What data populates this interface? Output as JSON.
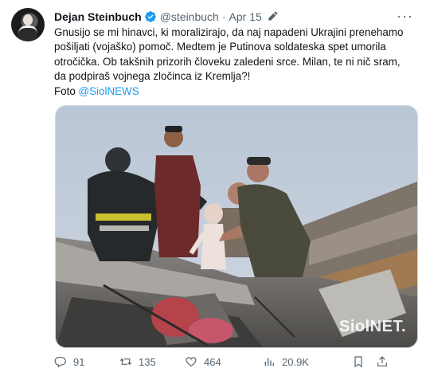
{
  "tweet": {
    "author_name": "Dejan Steinbuch",
    "handle": "@steinbuch",
    "separator": "·",
    "date": "Apr 15",
    "text_lines": [
      "Gnusijo se mi hinavci, ki moralizirajo, da naj napadeni Ukrajini prenehamo",
      "pošiljati (vojaško) pomoč. Medtem je Putinova soldateska spet umorila",
      "otročička. Ob takšnih prizorih človeku zaledeni srce. Milan, te ni nič sram,",
      "da podpiraš vojnega zločinca iz Kremlja?!"
    ],
    "foto_label": "Foto",
    "foto_mention": "@SiolNEWS",
    "more_label": "···"
  },
  "media": {
    "watermark": "SiolNET."
  },
  "stats": {
    "replies": "91",
    "retweets": "135",
    "likes": "464",
    "views": "20.9K"
  },
  "colors": {
    "accent": "#1d9bf0",
    "muted": "#536471",
    "text": "#0f1419"
  },
  "icons": [
    "verified-badge-icon",
    "edit-pencil-icon",
    "more-icon",
    "reply-icon",
    "retweet-icon",
    "like-icon",
    "views-icon",
    "bookmark-icon",
    "share-icon"
  ]
}
